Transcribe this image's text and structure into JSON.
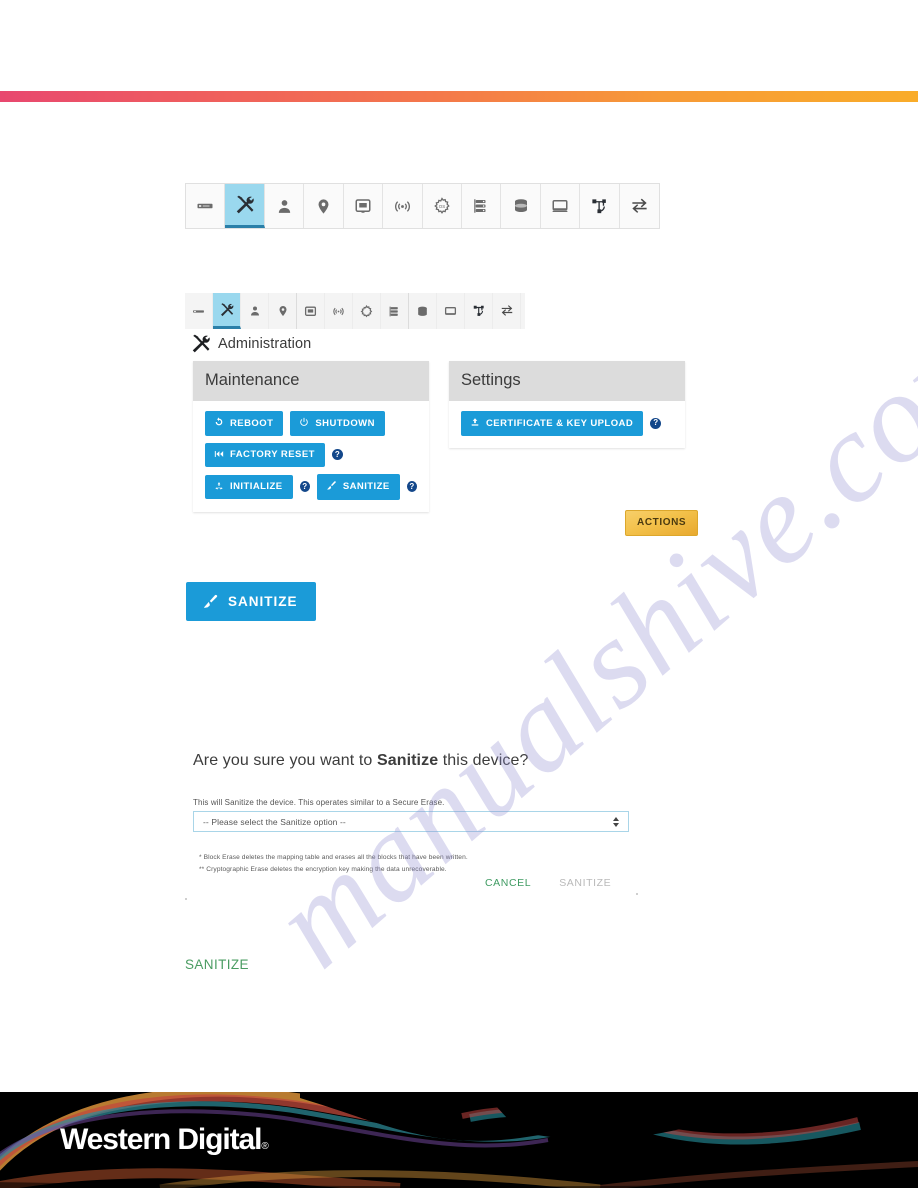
{
  "watermark": {
    "text": "manualshive.com"
  },
  "toolbar_main": {
    "items": [
      {
        "name": "server-icon",
        "label": "Server"
      },
      {
        "name": "tools-icon",
        "label": "Administration",
        "active": true
      },
      {
        "name": "user-icon",
        "label": "User"
      },
      {
        "name": "location-pin-icon",
        "label": "Location"
      },
      {
        "name": "enclosure-icon",
        "label": "Enclosure"
      },
      {
        "name": "wireless-icon",
        "label": "Connectivity"
      },
      {
        "name": "gear-os-icon",
        "label": "OS"
      },
      {
        "name": "drives-icon",
        "label": "Drives"
      },
      {
        "name": "database-icon",
        "label": "Storage"
      },
      {
        "name": "monitor-icon",
        "label": "Monitor"
      },
      {
        "name": "topology-icon",
        "label": "Topology"
      },
      {
        "name": "transfer-icon",
        "label": "Transfer"
      }
    ]
  },
  "screenshot": {
    "page_title": "Administration",
    "page_icon": "tools-icon",
    "maintenance": {
      "title": "Maintenance",
      "buttons": [
        {
          "label": "REBOOT",
          "icon": "reboot-icon",
          "help": false
        },
        {
          "label": "SHUTDOWN",
          "icon": "power-icon",
          "help": false
        },
        {
          "label": "FACTORY RESET",
          "icon": "rewind-icon",
          "help": true
        },
        {
          "label": "INITIALIZE",
          "icon": "recycle-icon",
          "help": true
        },
        {
          "label": "SANITIZE",
          "icon": "brush-icon",
          "help": true
        }
      ]
    },
    "settings": {
      "title": "Settings",
      "buttons": [
        {
          "label": "CERTIFICATE & KEY  UPLOAD",
          "icon": "upload-icon",
          "help": true
        }
      ]
    },
    "actions_button": {
      "label": "ACTIONS"
    }
  },
  "standalone_button": {
    "label": "SANITIZE",
    "icon": "brush-icon"
  },
  "dialog": {
    "question_prefix": "Are you sure you want to ",
    "question_emphasis": "Sanitize",
    "question_suffix": " this device?",
    "description": "This will Sanitize the device. This operates similar to a Secure Erase.",
    "select_value": "-- Please select the Sanitize option --",
    "footnotes": [
      "* Block Erase deletes the mapping table and erases all the blocks that have been written.",
      "** Cryptographic Erase deletes the encryption key making the data unrecoverable."
    ],
    "cancel_label": "CANCEL",
    "confirm_label": "SANITIZE"
  },
  "green_label": {
    "text": "SANITIZE"
  },
  "footer": {
    "brand": "Western Digital",
    "registered": "®"
  },
  "colors": {
    "accent_blue": "#1b9bd8",
    "help_navy": "#13478a",
    "actions_gold": "#f3c14a",
    "green": "#3f9b62",
    "disabled_gray": "#b9b9b9",
    "active_tab": "#9ad8ee",
    "gradient_start": "#e8486f",
    "gradient_end": "#f9ac2a"
  }
}
